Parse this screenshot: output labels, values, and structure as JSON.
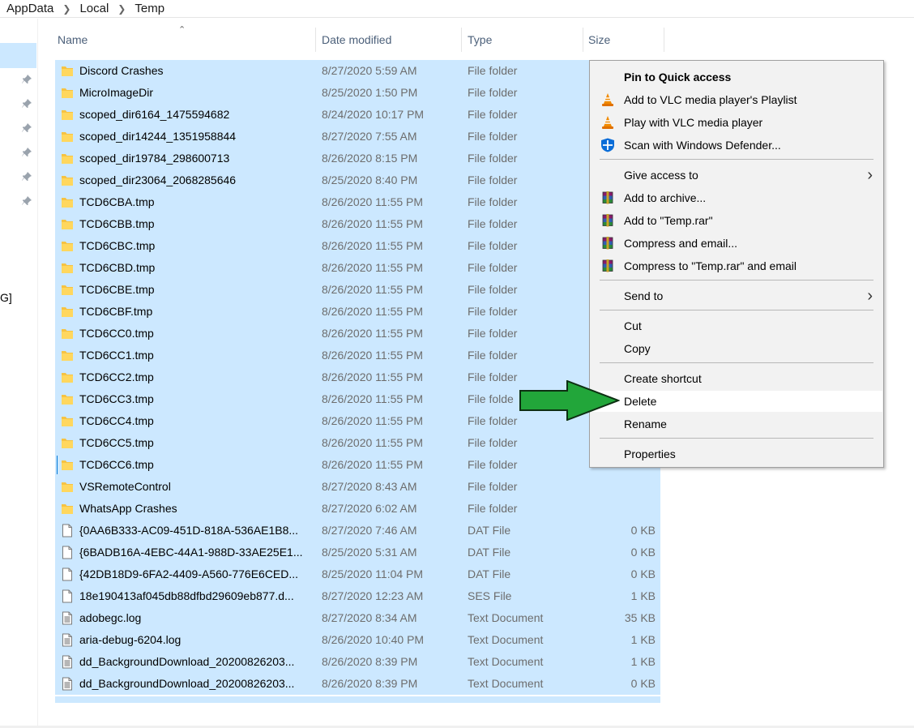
{
  "breadcrumb": [
    "AppData",
    "Local",
    "Temp"
  ],
  "nav": {
    "fragment": "G]"
  },
  "columns": {
    "name": "Name",
    "date": "Date modified",
    "type": "Type",
    "size": "Size"
  },
  "rows": [
    {
      "name": "Discord Crashes",
      "date": "8/27/2020 5:59 AM",
      "type": "File folder",
      "size": "",
      "icon": "folder-icon"
    },
    {
      "name": "MicroImageDir",
      "date": "8/25/2020 1:50 PM",
      "type": "File folder",
      "size": "",
      "icon": "folder-icon"
    },
    {
      "name": "scoped_dir6164_1475594682",
      "date": "8/24/2020 10:17 PM",
      "type": "File folder",
      "size": "",
      "icon": "folder-icon"
    },
    {
      "name": "scoped_dir14244_1351958844",
      "date": "8/27/2020 7:55 AM",
      "type": "File folder",
      "size": "",
      "icon": "folder-icon"
    },
    {
      "name": "scoped_dir19784_298600713",
      "date": "8/26/2020 8:15 PM",
      "type": "File folder",
      "size": "",
      "icon": "folder-icon"
    },
    {
      "name": "scoped_dir23064_2068285646",
      "date": "8/25/2020 8:40 PM",
      "type": "File folder",
      "size": "",
      "icon": "folder-icon"
    },
    {
      "name": "TCD6CBA.tmp",
      "date": "8/26/2020 11:55 PM",
      "type": "File folder",
      "size": "",
      "icon": "folder-icon"
    },
    {
      "name": "TCD6CBB.tmp",
      "date": "8/26/2020 11:55 PM",
      "type": "File folder",
      "size": "",
      "icon": "folder-icon"
    },
    {
      "name": "TCD6CBC.tmp",
      "date": "8/26/2020 11:55 PM",
      "type": "File folder",
      "size": "",
      "icon": "folder-icon"
    },
    {
      "name": "TCD6CBD.tmp",
      "date": "8/26/2020 11:55 PM",
      "type": "File folder",
      "size": "",
      "icon": "folder-icon"
    },
    {
      "name": "TCD6CBE.tmp",
      "date": "8/26/2020 11:55 PM",
      "type": "File folder",
      "size": "",
      "icon": "folder-icon"
    },
    {
      "name": "TCD6CBF.tmp",
      "date": "8/26/2020 11:55 PM",
      "type": "File folder",
      "size": "",
      "icon": "folder-icon"
    },
    {
      "name": "TCD6CC0.tmp",
      "date": "8/26/2020 11:55 PM",
      "type": "File folder",
      "size": "",
      "icon": "folder-icon"
    },
    {
      "name": "TCD6CC1.tmp",
      "date": "8/26/2020 11:55 PM",
      "type": "File folder",
      "size": "",
      "icon": "folder-icon"
    },
    {
      "name": "TCD6CC2.tmp",
      "date": "8/26/2020 11:55 PM",
      "type": "File folder",
      "size": "",
      "icon": "folder-icon"
    },
    {
      "name": "TCD6CC3.tmp",
      "date": "8/26/2020 11:55 PM",
      "type": "File folde",
      "size": "",
      "icon": "folder-icon"
    },
    {
      "name": "TCD6CC4.tmp",
      "date": "8/26/2020 11:55 PM",
      "type": "File folder",
      "size": "",
      "icon": "folder-icon"
    },
    {
      "name": "TCD6CC5.tmp",
      "date": "8/26/2020 11:55 PM",
      "type": "File folder",
      "size": "",
      "icon": "folder-icon"
    },
    {
      "name": "TCD6CC6.tmp",
      "date": "8/26/2020 11:55 PM",
      "type": "File folder",
      "size": "",
      "icon": "folder-icon"
    },
    {
      "name": "VSRemoteControl",
      "date": "8/27/2020 8:43 AM",
      "type": "File folder",
      "size": "",
      "icon": "folder-icon"
    },
    {
      "name": "WhatsApp Crashes",
      "date": "8/27/2020 6:02 AM",
      "type": "File folder",
      "size": "",
      "icon": "folder-icon"
    },
    {
      "name": "{0AA6B333-AC09-451D-818A-536AE1B8...",
      "date": "8/27/2020 7:46 AM",
      "type": "DAT File",
      "size": "0 KB",
      "icon": "file-icon"
    },
    {
      "name": "{6BADB16A-4EBC-44A1-988D-33AE25E1...",
      "date": "8/25/2020 5:31 AM",
      "type": "DAT File",
      "size": "0 KB",
      "icon": "file-icon"
    },
    {
      "name": "{42DB18D9-6FA2-4409-A560-776E6CED...",
      "date": "8/25/2020 11:04 PM",
      "type": "DAT File",
      "size": "0 KB",
      "icon": "file-icon"
    },
    {
      "name": "18e190413af045db88dfbd29609eb877.d...",
      "date": "8/27/2020 12:23 AM",
      "type": "SES File",
      "size": "1 KB",
      "icon": "file-icon"
    },
    {
      "name": "adobegc.log",
      "date": "8/27/2020 8:34 AM",
      "type": "Text Document",
      "size": "35 KB",
      "icon": "text-document-icon"
    },
    {
      "name": "aria-debug-6204.log",
      "date": "8/26/2020 10:40 PM",
      "type": "Text Document",
      "size": "1 KB",
      "icon": "text-document-icon"
    },
    {
      "name": "dd_BackgroundDownload_20200826203...",
      "date": "8/26/2020 8:39 PM",
      "type": "Text Document",
      "size": "1 KB",
      "icon": "text-document-icon"
    },
    {
      "name": "dd_BackgroundDownload_20200826203...",
      "date": "8/26/2020 8:39 PM",
      "type": "Text Document",
      "size": "0 KB",
      "icon": "text-document-icon"
    }
  ],
  "context_menu": {
    "items": [
      {
        "label": "Pin to Quick access",
        "bold": true,
        "icon": ""
      },
      {
        "label": "Add to VLC media player's Playlist",
        "icon": "vlc-icon"
      },
      {
        "label": "Play with VLC media player",
        "icon": "vlc-icon"
      },
      {
        "label": "Scan with Windows Defender...",
        "icon": "windows-defender-icon"
      },
      {
        "label": "Give access to",
        "submenu": true
      },
      {
        "label": "Add to archive...",
        "icon": "winrar-icon"
      },
      {
        "label": "Add to \"Temp.rar\"",
        "icon": "winrar-icon"
      },
      {
        "label": "Compress and email...",
        "icon": "winrar-icon"
      },
      {
        "label": "Compress to \"Temp.rar\" and email",
        "icon": "winrar-icon"
      },
      {
        "label": "Send to",
        "submenu": true
      },
      {
        "label": "Cut"
      },
      {
        "label": "Copy"
      },
      {
        "label": "Create shortcut"
      },
      {
        "label": "Delete",
        "highlighted": true
      },
      {
        "label": "Rename"
      },
      {
        "label": "Properties"
      }
    ]
  },
  "colors": {
    "selection": "#cce8ff",
    "menu_bg": "#f2f2f2",
    "arrow_fill": "#22a63a",
    "folder": "#f6c343"
  }
}
